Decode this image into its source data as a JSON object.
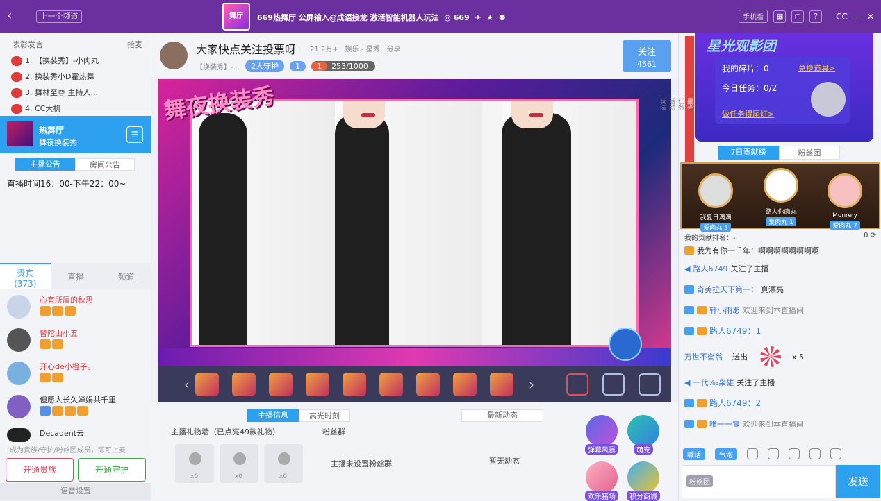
{
  "topbar": {
    "back_icon": "back-arrow-icon",
    "prev_label": "上一个频道",
    "logo_text": "舞厅",
    "title": "669热舞厅 公屏输入@成语接龙 激活智能机器人玩法",
    "count": "669",
    "mobile_label": "手机看"
  },
  "left": {
    "header_left": "表彰发言",
    "header_right": "拾麦",
    "ranks": [
      "1. 【换装秀】-小肉丸",
      "2. 换装秀小D霍热舞",
      "3. 舞林至尊 主持人...",
      "4. CC大机"
    ],
    "room_name": "热舞厅",
    "room_sub": "舞夜换装秀",
    "tab_notice": "主播公告",
    "tab_room": "房间公告",
    "notice_text": "直播时间16：00-下午22：00~",
    "viewer_tabs": {
      "vip": "贵宾",
      "vip_count": "(373)",
      "broadcast": "直播",
      "channel": "频道"
    },
    "users": [
      {
        "name": "心有所属的秋思"
      },
      {
        "name": "替陀山小五"
      },
      {
        "name": "开心de小橙子。"
      },
      {
        "name": "但愿人长久婵娟共千里"
      },
      {
        "name": "Decadent云"
      }
    ],
    "footer_hint": "成为贵族/守护/粉丝团成员，即可上麦",
    "open_noble": "开通贵族",
    "open_guard": "开通守护",
    "voice_settings": "语音设置"
  },
  "anchor": {
    "title": "大家快点关注投票呀",
    "heat": "21.2万+",
    "category": "娱乐 - 星秀",
    "share": "分享",
    "tag": "【换装秀】-...",
    "guard": "2人守护",
    "fans": "1",
    "level": "1",
    "progress": "253/1000",
    "follow_label": "关注",
    "follow_count": "4561"
  },
  "video": {
    "overlay_title": "舞夜换装秀"
  },
  "lower": {
    "tab_info": "主播信息",
    "tab_highlight": "高光时刻",
    "news_label": "最新动态",
    "gift_wall": "主播礼物墙（已点亮49款礼物）",
    "fans_group": "粉丝群",
    "slots": [
      "x0",
      "x0",
      "x0"
    ],
    "no_fans": "主播未设置粉丝群",
    "no_news": "暂无动态",
    "apps": [
      "弹幕风暴",
      "萌宠",
      "欢乐猪场",
      "积分商城"
    ]
  },
  "right": {
    "side_tabs": [
      "星光",
      "任务",
      "活动",
      "玩法"
    ],
    "star_title": "星光观影团",
    "fragments": "我的碎片：0",
    "exchange": "兑换道具>",
    "tasks": "今日任务：0/2",
    "get_lights": "做任务得尾灯>",
    "rank_tab": "7日贡献榜",
    "fans_tab": "粉丝团",
    "top3": [
      {
        "name": "我夏日满满",
        "tag": "爱肉丸 5"
      },
      {
        "name": "路人你肉丸",
        "tag": "爱肉丸 1"
      },
      {
        "name": "Monrely",
        "tag": "爱肉丸 7"
      }
    ],
    "my_rank": "我的贡献排名：-",
    "my_rank_val": "0",
    "chat": [
      {
        "name": "",
        "text": "我为有你一千年：啊啊啊啊啊啊啊啊"
      },
      {
        "name": "路人6749",
        "text": "关注了主播"
      },
      {
        "name": "奇美拉天下第一：",
        "text": "真漂亮"
      },
      {
        "name": "轩小雨あ",
        "text": "欢迎来到本直播间"
      },
      {
        "name": "路人6749：1",
        "text": ""
      },
      {
        "name": "万世不衡翁",
        "text": "送出",
        "extra": "x 5"
      },
      {
        "name": "一代‰枭雄",
        "text": "关注了主播"
      },
      {
        "name": "路人6749：2",
        "text": ""
      },
      {
        "name": "唯一一零",
        "text": "欢迎来到本直播间"
      }
    ],
    "btn_speak": "喊话",
    "btn_bubble": "气泡",
    "fan_badge": "粉丝团",
    "send": "发送"
  }
}
